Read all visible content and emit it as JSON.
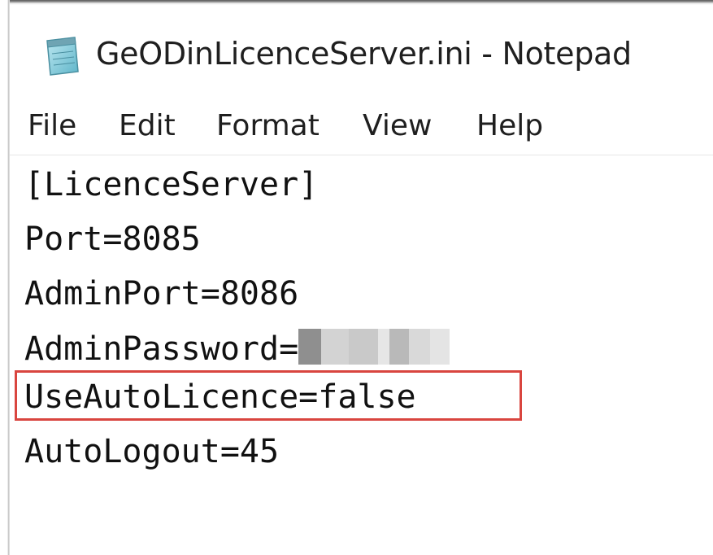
{
  "window": {
    "title": "GeODinLicenceServer.ini - Notepad",
    "icon": "notepad-icon"
  },
  "menubar": {
    "items": [
      {
        "label": "File"
      },
      {
        "label": "Edit"
      },
      {
        "label": "Format"
      },
      {
        "label": "View"
      },
      {
        "label": "Help"
      }
    ]
  },
  "editor": {
    "lines": [
      "[LicenceServer]",
      "Port=8085",
      "AdminPort=8086",
      "AdminPassword=",
      "UseAutoLicence=false",
      "AutoLogout=45"
    ],
    "redacted_value_line": 3,
    "highlighted_line": 4
  },
  "colors": {
    "highlight_border": "#d9453f",
    "text": "#111111",
    "background": "#ffffff"
  }
}
